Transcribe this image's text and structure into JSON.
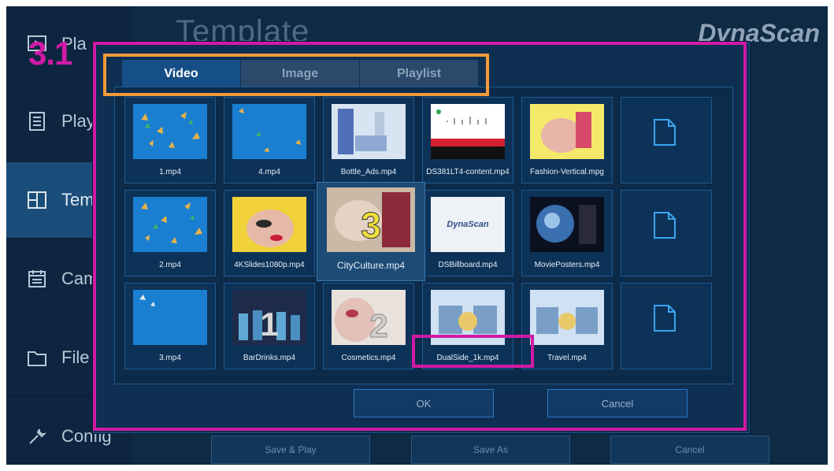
{
  "step_label": "3.1",
  "background": {
    "title": "Template",
    "brand": "DynaScan",
    "buttons": [
      "Save & Play",
      "Save As",
      "Cancel"
    ]
  },
  "sidebar": {
    "items": [
      {
        "label": "Pla",
        "icon": "play-icon",
        "active": false
      },
      {
        "label": "Play",
        "icon": "list-icon",
        "active": false
      },
      {
        "label": "Temp",
        "icon": "template-icon",
        "active": true
      },
      {
        "label": "Camp",
        "icon": "calendar-icon",
        "active": false
      },
      {
        "label": "File M",
        "icon": "folder-icon",
        "active": false
      },
      {
        "label": "Config",
        "icon": "wrench-icon",
        "active": false
      }
    ]
  },
  "dialog": {
    "tabs": [
      {
        "label": "Video",
        "active": true
      },
      {
        "label": "Image",
        "active": false
      },
      {
        "label": "Playlist",
        "active": false
      }
    ],
    "files": [
      [
        "1.mp4",
        "4.mp4",
        "Bottle_Ads.mp4",
        "DS381LT4-content.mp4",
        "Fashion-Vertical.mpg",
        ""
      ],
      [
        "2.mp4",
        "4KSlides1080p.mp4",
        "CityCulture.mp4",
        "DSBillboard.mp4",
        "MoviePosters.mp4",
        ""
      ],
      [
        "3.mp4",
        "BarDrinks.mp4",
        "Cosmetics.mp4",
        "DualSide_1k.mp4",
        "Travel.mp4",
        ""
      ]
    ],
    "selected_file": "CityCulture.mp4",
    "thumb_texts": {
      "dynascan": "DynaScan",
      "city": "3",
      "bar": "1",
      "cos": "2"
    },
    "ok_label": "OK",
    "cancel_label": "Cancel"
  },
  "colors": {
    "annotation_magenta": "#d01aa6",
    "annotation_orange": "#f39a3a",
    "active_tab": "#154f86"
  }
}
